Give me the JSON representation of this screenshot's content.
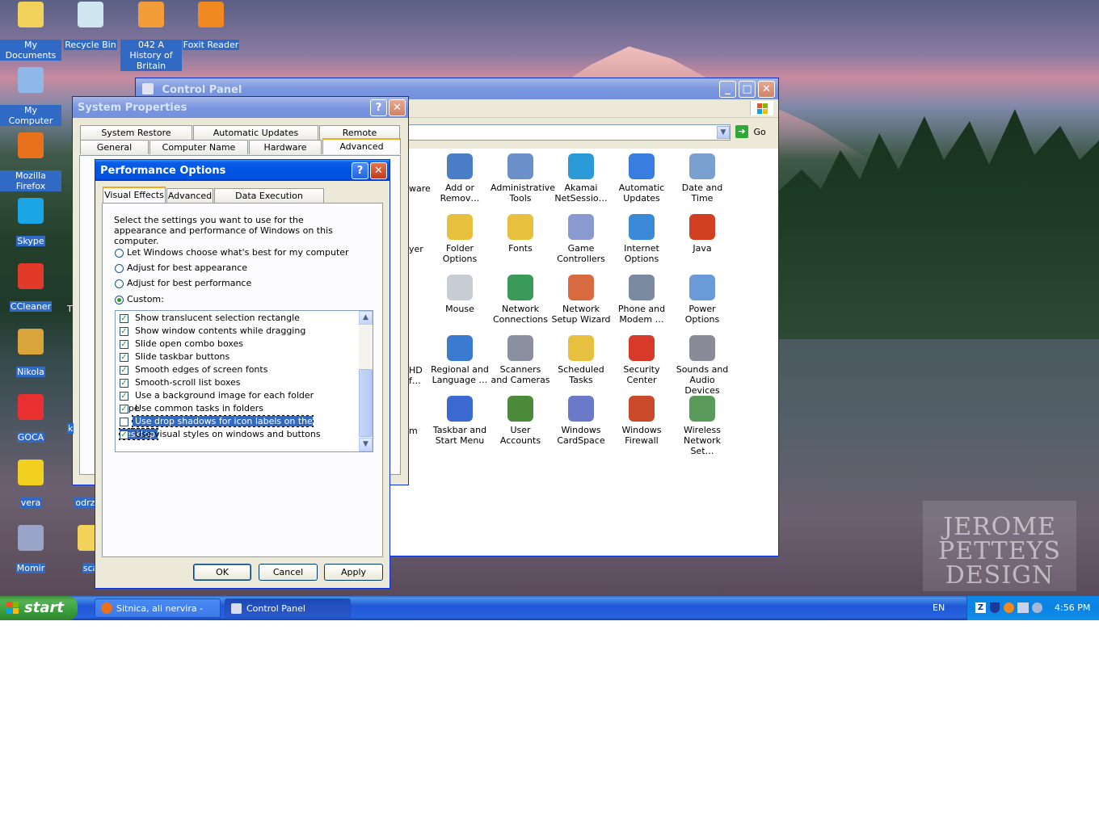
{
  "desktop": {
    "icons": [
      {
        "label": "My Documents",
        "icon": "folder-documents-icon",
        "color": "#f2d25a"
      },
      {
        "label": "Recycle Bin",
        "icon": "recycle-bin-icon",
        "color": "#cfe6ef"
      },
      {
        "label": "042 A History of Britain",
        "icon": "pdf-file-icon",
        "color": "#f39c3a"
      },
      {
        "label": "Foxit Reader",
        "icon": "foxit-reader-icon",
        "color": "#f08a20"
      },
      {
        "label": "My Computer",
        "icon": "my-computer-icon",
        "color": "#8fb8e8"
      },
      {
        "label": "Mozilla Firefox",
        "icon": "firefox-icon",
        "color": "#e8711c"
      },
      {
        "label": "Skype",
        "icon": "skype-icon",
        "color": "#1aa6e6"
      },
      {
        "label": "CCleaner",
        "icon": "ccleaner-icon",
        "color": "#e23a2a"
      },
      {
        "label": "Nikola",
        "icon": "drink-icon",
        "color": "#d9a43a"
      },
      {
        "label": "GOCA",
        "icon": "sneaker-icon",
        "color": "#e83030"
      },
      {
        "label": "vera",
        "icon": "ladybug-icon",
        "color": "#f2d020"
      },
      {
        "label": "Momir",
        "icon": "mouse-character-icon",
        "color": "#9aa4c8"
      },
      {
        "label": "odrzav",
        "icon": "shortcut-icon",
        "color": "#6a8ab8"
      },
      {
        "label": "sca",
        "icon": "folder-icon",
        "color": "#f2d25a"
      }
    ],
    "watermark": [
      "JEROME",
      "PETTEYS",
      "DESIGN"
    ]
  },
  "control_panel": {
    "title": "Control Panel",
    "go_label": "Go",
    "partial_labels": [
      "ware",
      "yer",
      "HD",
      "f…",
      "m"
    ],
    "items": [
      {
        "label": "Add or Remov…",
        "icon": "add-remove-programs-icon",
        "color": "#4a7fc8"
      },
      {
        "label": "Administrative Tools",
        "icon": "administrative-tools-icon",
        "color": "#6b8fc8"
      },
      {
        "label": "Akamai NetSessio…",
        "icon": "akamai-icon",
        "color": "#2a9ad8"
      },
      {
        "label": "Automatic Updates",
        "icon": "automatic-updates-icon",
        "color": "#3a7de0"
      },
      {
        "label": "Date and Time",
        "icon": "date-time-icon",
        "color": "#7aa0d0"
      },
      {
        "label": "Folder Options",
        "icon": "folder-options-icon",
        "color": "#e8c040"
      },
      {
        "label": "Fonts",
        "icon": "fonts-icon",
        "color": "#e8c040"
      },
      {
        "label": "Game Controllers",
        "icon": "game-controllers-icon",
        "color": "#8a9ad0"
      },
      {
        "label": "Internet Options",
        "icon": "internet-options-icon",
        "color": "#3a8ad8"
      },
      {
        "label": "Java",
        "icon": "java-icon",
        "color": "#d04020"
      },
      {
        "label": "Mouse",
        "icon": "mouse-icon",
        "color": "#c8ccd4"
      },
      {
        "label": "Network Connections",
        "icon": "network-connections-icon",
        "color": "#3a9a5a"
      },
      {
        "label": "Network Setup Wizard",
        "icon": "network-setup-wizard-icon",
        "color": "#d86a40"
      },
      {
        "label": "Phone and Modem …",
        "icon": "phone-modem-icon",
        "color": "#7a8aa0"
      },
      {
        "label": "Power Options",
        "icon": "power-options-icon",
        "color": "#6a9ad8"
      },
      {
        "label": "Regional and Language …",
        "icon": "regional-language-icon",
        "color": "#3a7ad0"
      },
      {
        "label": "Scanners and Cameras",
        "icon": "scanners-cameras-icon",
        "color": "#8a90a0"
      },
      {
        "label": "Scheduled Tasks",
        "icon": "scheduled-tasks-icon",
        "color": "#e8c040"
      },
      {
        "label": "Security Center",
        "icon": "security-center-icon",
        "color": "#d83a2a"
      },
      {
        "label": "Sounds and Audio Devices",
        "icon": "sounds-audio-icon",
        "color": "#8a8a98"
      },
      {
        "label": "Taskbar and Start Menu",
        "icon": "taskbar-start-menu-icon",
        "color": "#3a6ad0"
      },
      {
        "label": "User Accounts",
        "icon": "user-accounts-icon",
        "color": "#4a8a3a"
      },
      {
        "label": "Windows CardSpace",
        "icon": "cardspace-icon",
        "color": "#6a7ac8"
      },
      {
        "label": "Windows Firewall",
        "icon": "windows-firewall-icon",
        "color": "#c84a2a"
      },
      {
        "label": "Wireless Network Set…",
        "icon": "wireless-network-icon",
        "color": "#5a9a5a"
      }
    ]
  },
  "system_properties": {
    "title": "System Properties",
    "tabs_back": [
      "System Restore",
      "Automatic Updates",
      "Remote"
    ],
    "tabs_front": [
      "General",
      "Computer Name",
      "Hardware",
      "Advanced"
    ],
    "partial_labels": [
      "T",
      "k"
    ]
  },
  "performance_options": {
    "title": "Performance Options",
    "tabs": [
      "Visual Effects",
      "Advanced",
      "Data Execution Prevention"
    ],
    "description": "Select the settings you want to use for the appearance and performance of Windows on this computer.",
    "radios": [
      {
        "label": "Let Windows choose what's best for my computer",
        "checked": false
      },
      {
        "label": "Adjust for best appearance",
        "checked": false
      },
      {
        "label": "Adjust for best performance",
        "checked": false
      },
      {
        "label": "Custom:",
        "checked": true
      }
    ],
    "options": [
      {
        "label": "Show translucent selection rectangle",
        "checked": true
      },
      {
        "label": "Show window contents while dragging",
        "checked": true
      },
      {
        "label": "Slide open combo boxes",
        "checked": true
      },
      {
        "label": "Slide taskbar buttons",
        "checked": true
      },
      {
        "label": "Smooth edges of screen fonts",
        "checked": true
      },
      {
        "label": "Smooth-scroll list boxes",
        "checked": true
      },
      {
        "label": "Use a background image for each folder type",
        "checked": true
      },
      {
        "label": "Use common tasks in folders",
        "checked": true
      },
      {
        "label": "Use drop shadows for icon labels on the desktop",
        "checked": false,
        "selected": true
      },
      {
        "label": "Use visual styles on windows and buttons",
        "checked": true
      }
    ],
    "buttons": {
      "ok": "OK",
      "cancel": "Cancel",
      "apply": "Apply"
    }
  },
  "taskbar": {
    "start_label": "start",
    "tasks": [
      {
        "label": "Sitnica, ali nervira - M...",
        "icon": "firefox-icon",
        "active": false
      },
      {
        "label": "Control Panel",
        "icon": "control-panel-icon",
        "active": true
      }
    ],
    "language": "EN",
    "clock": "4:56 PM"
  }
}
